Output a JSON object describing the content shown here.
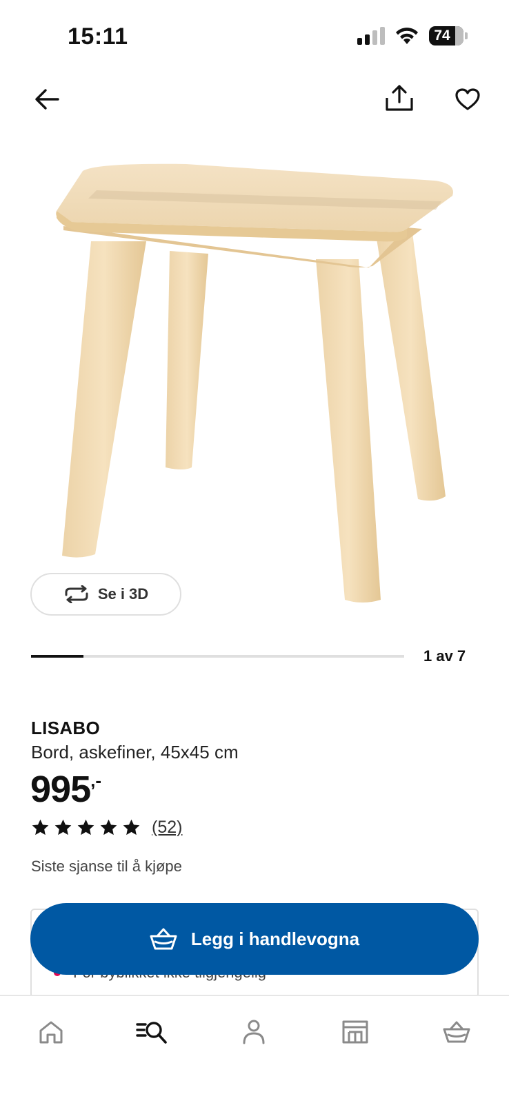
{
  "status_bar": {
    "time": "15:11",
    "battery": "74"
  },
  "nav": {
    "back_icon": "arrow-left-icon",
    "share_icon": "share-icon",
    "favorite_icon": "heart-icon"
  },
  "gallery": {
    "view_3d_label": "Se i 3D",
    "view_3d_icon": "rotate-icon",
    "counter": "1 av 7",
    "progress": 0.14
  },
  "product": {
    "name": "LISABO",
    "description": "Bord, askefiner, 45x45 cm",
    "price": "995",
    "price_suffix": ",-",
    "rating": 5,
    "review_count": "(52)",
    "availability_note": "Siste sjanse til å kjøpe"
  },
  "stock": {
    "text": "For bybilkket ikke tilgjengelig",
    "status_color": "#e00751"
  },
  "cta": {
    "label": "Legg i handlevogna",
    "icon": "basket-icon",
    "color": "#0058a3"
  },
  "tab_bar": {
    "items": [
      {
        "icon": "home-icon"
      },
      {
        "icon": "search-icon",
        "active": true
      },
      {
        "icon": "profile-icon"
      },
      {
        "icon": "store-icon"
      },
      {
        "icon": "basket-icon"
      }
    ]
  }
}
